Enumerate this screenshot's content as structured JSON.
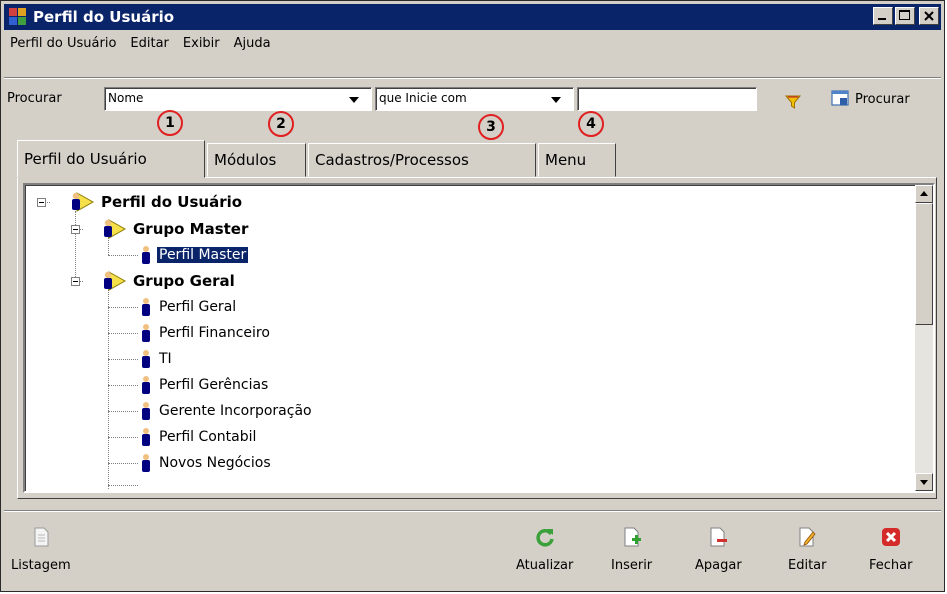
{
  "window": {
    "title": "Perfil do Usuário"
  },
  "menu": [
    "Perfil do Usuário",
    "Editar",
    "Exibir",
    "Ajuda"
  ],
  "search": {
    "label": "Procurar",
    "field_value": "Nome",
    "condition_value": "que Inicie com",
    "text_value": "",
    "button_label": "Procurar"
  },
  "markers": [
    "1",
    "2",
    "3",
    "4"
  ],
  "tabs": [
    "Perfil do Usuário",
    "Módulos",
    "Cadastros/Processos",
    "Menu"
  ],
  "tree": {
    "root": "Perfil do Usuário",
    "groups": [
      {
        "label": "Grupo Master",
        "items": [
          "Perfil Master"
        ]
      },
      {
        "label": "Grupo Geral",
        "items": [
          "Perfil Geral",
          "Perfil Financeiro",
          "TI",
          "Perfil Gerências",
          "Gerente Incorporação",
          "Perfil Contabil",
          "Novos Negócios"
        ]
      }
    ],
    "selected": "Perfil Master"
  },
  "toolbar": {
    "listagem": "Listagem",
    "atualizar": "Atualizar",
    "inserir": "Inserir",
    "apagar": "Apagar",
    "editar": "Editar",
    "fechar": "Fechar"
  },
  "colors": {
    "title_bar": "#0a246a",
    "marker": "#e02020",
    "selection": "#0a246a"
  }
}
